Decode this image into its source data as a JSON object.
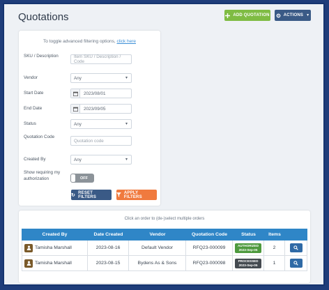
{
  "header": {
    "title": "Quotations",
    "add_button": "ADD QUOTATION",
    "actions_button": "ACTIONS"
  },
  "filters": {
    "toggle_text": "To toggle advanced filtering options,",
    "toggle_link": "click here",
    "sku_label": "SKU / Description",
    "sku_placeholder": "Item SKU / Description / Code",
    "vendor_label": "Vendor",
    "vendor_value": "Any",
    "start_label": "Start Date",
    "start_value": "2023/08/01",
    "end_label": "End Date",
    "end_value": "2023/09/05",
    "status_label": "Status",
    "status_value": "Any",
    "code_label": "Quotation Code",
    "code_placeholder": "Quotation code",
    "created_label": "Created By",
    "created_value": "Any",
    "auth_label": "Show requiring my authorization",
    "auth_toggle": "OFF",
    "reset_button": "RESET FILTERS",
    "apply_button": "APPLY FILTERS"
  },
  "table": {
    "hint": "Click an order to (de-)select multiple orders",
    "columns": [
      "Created By",
      "Date Created",
      "Vendor",
      "Quotation Code",
      "Status",
      "Items"
    ],
    "rows": [
      {
        "created_by": "Tamisha Marshall",
        "date": "2023-08-16",
        "vendor": "Default Vendor",
        "code": "RFQ23-000099",
        "status": "AUTHORIZED",
        "status_date": "2023-Sep-05",
        "status_color": "#4e9a3e",
        "items": "2"
      },
      {
        "created_by": "Tamisha Marshall",
        "date": "2023-08-15",
        "vendor": "Bydens As & Sons",
        "code": "RFQ23-000098",
        "status": "PROCESSED",
        "status_date": "2023-Sep-05",
        "status_color": "#444a50",
        "items": "1"
      }
    ]
  }
}
